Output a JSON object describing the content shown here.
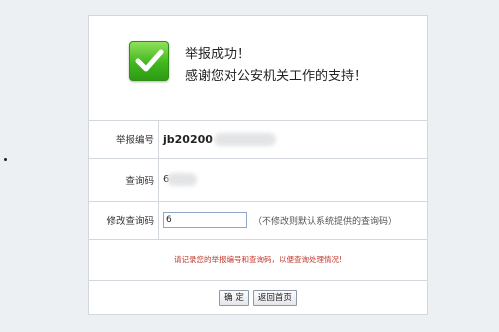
{
  "header": {
    "title": "举报成功！",
    "thanks": "感谢您对公安机关工作的支持！",
    "icon": "check-icon",
    "icon_color": "#41b81e"
  },
  "report_number": {
    "label": "举报编号",
    "value_visible": "jb20200"
  },
  "query_code": {
    "label": "查询码",
    "value_visible": "6"
  },
  "modify_code": {
    "label": "修改查询码",
    "input_value": "6",
    "hint": "（不修改则默认系统提供的查询码）"
  },
  "notice": {
    "text": "请记录您的举报编号和查询码，以便查询处理情况!",
    "color": "#c0392b"
  },
  "buttons": {
    "confirm": "确 定",
    "back_home": "返回首页"
  }
}
